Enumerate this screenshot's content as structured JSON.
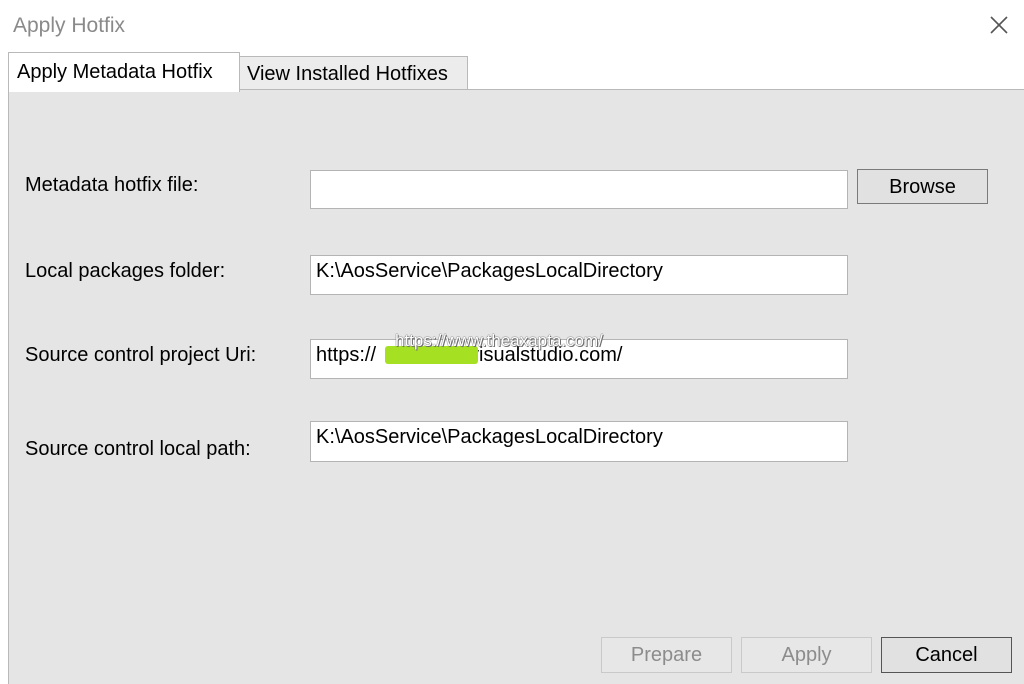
{
  "window": {
    "title": "Apply Hotfix",
    "close_icon": "close-icon"
  },
  "tabs": [
    {
      "label": "Apply Metadata Hotfix",
      "active": true
    },
    {
      "label": "View Installed Hotfixes",
      "active": false
    }
  ],
  "form": {
    "metadata_file": {
      "label": "Metadata hotfix file:",
      "value": ""
    },
    "browse_label": "Browse",
    "local_packages": {
      "label": "Local packages folder:",
      "value": "K:\\AosService\\PackagesLocalDirectory"
    },
    "source_uri": {
      "label": "Source control project Uri:",
      "value": "https://",
      "value_suffix": "visualstudio.com/"
    },
    "source_path": {
      "label": "Source control local path:",
      "value": "K:\\AosService\\PackagesLocalDirectory"
    }
  },
  "buttons": {
    "prepare": "Prepare",
    "apply": "Apply",
    "cancel": "Cancel"
  },
  "watermark": "https://www.theaxapta.com/",
  "colors": {
    "panel_bg": "#e5e5e5",
    "redaction_highlight": "#a6e022"
  }
}
